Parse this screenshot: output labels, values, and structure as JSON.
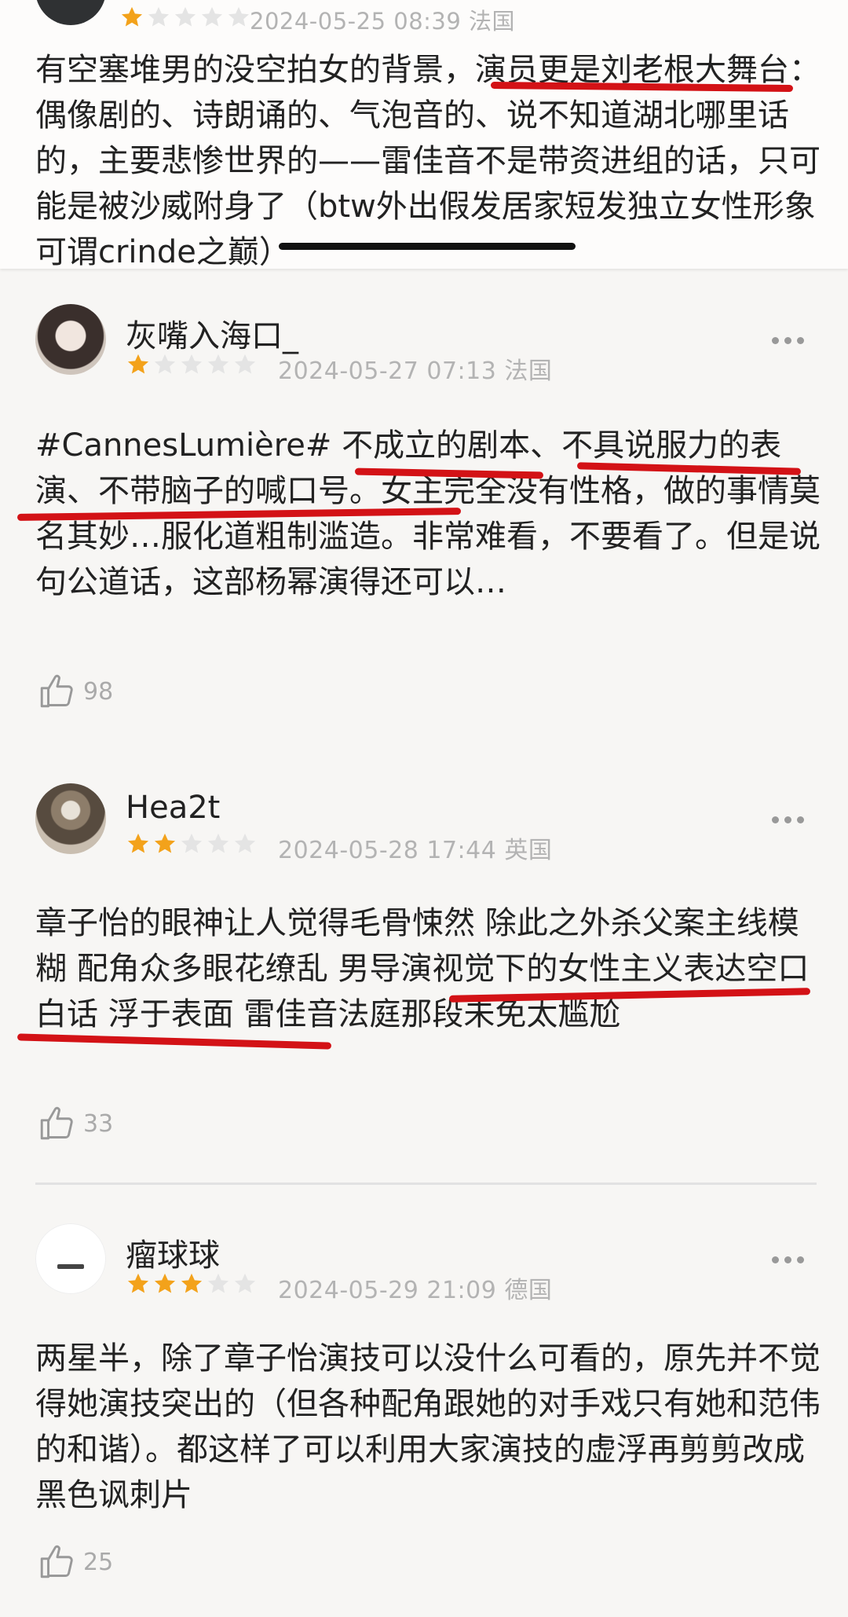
{
  "reviews": [
    {
      "username": "",
      "rating": 1,
      "date": "2024-05-25 08:39 法国",
      "text": "有空塞堆男的没空拍女的背景，演员更是刘老根大舞台：偶像剧的、诗朗诵的、气泡音的、说不知道湖北哪里话的，主要悲惨世界的——雷佳音不是带资进组的话，只可能是被沙威附身了（btw外出假发居家短发独立女性形象可谓crinde之巅）"
    },
    {
      "username": "灰嘴入海口_",
      "rating": 1,
      "date": "2024-05-27 07:13 法国",
      "text": "#CannesLumière# 不成立的剧本、不具说服力的表演、不带脑子的喊口号。女主完全没有性格，做的事情莫名其妙…服化道粗制滥造。非常难看，不要看了。但是说句公道话，这部杨幂演得还可以…",
      "likes": "98"
    },
    {
      "username": "Hea2t",
      "rating": 2,
      "date": "2024-05-28 17:44 英国",
      "text": "章子怡的眼神让人觉得毛骨悚然 除此之外杀父案主线模糊 配角众多眼花缭乱 男导演视觉下的女性主义表达空口白话 浮于表面 雷佳音法庭那段未免太尴尬",
      "likes": "33"
    },
    {
      "username": "瘤球球",
      "rating": 3,
      "date": "2024-05-29 21:09 德国",
      "text": "两星半，除了章子怡演技可以没什么可看的，原先并不觉得她演技突出的（但各种配角跟她的对手戏只有她和范伟的和谐）。都这样了可以利用大家演技的虚浮再剪剪改成黑色讽刺片",
      "likes": "25"
    }
  ],
  "colors": {
    "star_filled": "#f3a21b",
    "star_empty": "#e4e4e4",
    "highlight_underline": "#d31216",
    "meta_text": "#b3b3b3"
  },
  "icons": [
    "more-dots-icon",
    "thumbs-up-icon",
    "star-icon"
  ]
}
